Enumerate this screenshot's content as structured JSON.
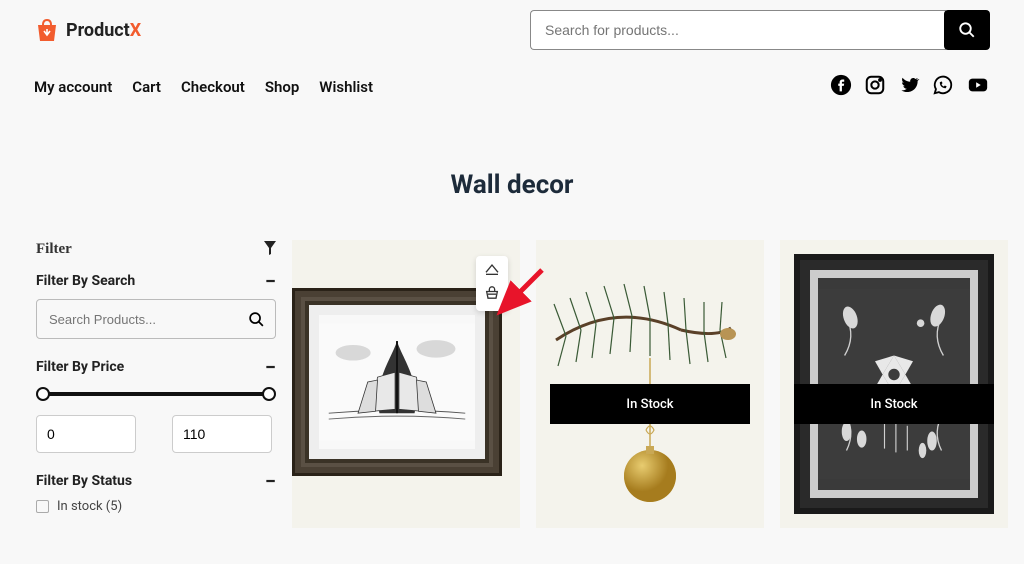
{
  "brand": {
    "name_first": "Product",
    "name_second": "X"
  },
  "search": {
    "placeholder": "Search for products..."
  },
  "nav": {
    "my_account": "My account",
    "cart": "Cart",
    "checkout": "Checkout",
    "shop": "Shop",
    "wishlist": "Wishlist"
  },
  "page_title": "Wall decor",
  "filter": {
    "title": "Filter",
    "by_search": {
      "label": "Filter By Search",
      "placeholder": "Search Products..."
    },
    "by_price": {
      "label": "Filter By Price",
      "min": "0",
      "max": "110"
    },
    "by_status": {
      "label": "Filter By Status",
      "items": [
        {
          "label": "In stock (5)",
          "checked": false
        }
      ]
    }
  },
  "products": [
    {
      "stock_badge": ""
    },
    {
      "stock_badge": "In Stock"
    },
    {
      "stock_badge": "In Stock"
    }
  ],
  "colors": {
    "accent": "#f25c2e"
  }
}
